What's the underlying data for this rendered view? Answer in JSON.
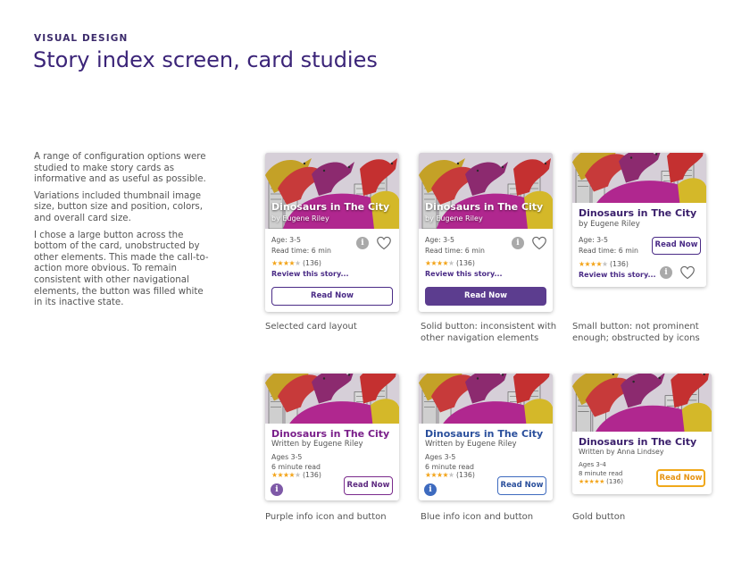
{
  "header": {
    "eyebrow": "VISUAL DESIGN",
    "title": "Story index screen, card studies"
  },
  "description": [
    "A range of configuration options were studied to make story cards as informative and as useful as possible.",
    "Variations included thumbnail image size, button size and position, colors, and overall card size.",
    "I chose a large button across the bottom of the card, unobstructed by other elements. This made the call-to-action more obvious. To remain consistent with other navigational elements, the button was filled white in its inactive state."
  ],
  "colors": {
    "title": "#3b2478",
    "button_purple": "#4a2b86",
    "button_solid": "#5c3d8f",
    "button_blue": "#3e6bbf",
    "button_gold": "#f0a81a",
    "star": "#f3a51c"
  },
  "cards": [
    {
      "title": "Dinosaurs in The City",
      "author": "by Eugene Riley",
      "age": "Age: 3-5",
      "read_time": "Read time: 6 min",
      "rating_stars": 4,
      "rating_count": "(136)",
      "review_link": "Review this story...",
      "button": "Read Now",
      "caption": "Selected card layout"
    },
    {
      "title": "Dinosaurs in The City",
      "author": "by Eugene Riley",
      "age": "Age: 3-5",
      "read_time": "Read time: 6 min",
      "rating_stars": 4,
      "rating_count": "(136)",
      "review_link": "Review this story...",
      "button": "Read Now",
      "caption": "Solid button: inconsistent with other navigation elements"
    },
    {
      "title": "Dinosaurs in The City",
      "author": "by Eugene Riley",
      "age": "Age: 3-5",
      "read_time": "Read time: 6 min",
      "rating_stars": 4,
      "rating_count": "(136)",
      "review_link": "Review this story...",
      "button": "Read Now",
      "caption": "Small button: not prominent enough; obstructed by icons"
    },
    {
      "title": "Dinosaurs in The City",
      "author": "Written by Eugene Riley",
      "age": "Ages 3-5",
      "read_time": "6 minute read",
      "rating_stars": 4,
      "rating_count": "(136)",
      "button": "Read Now",
      "caption": "Purple info icon and button"
    },
    {
      "title": "Dinosaurs in The City",
      "author": "Written by Eugene Riley",
      "age": "Ages 3-5",
      "read_time": "6 minute read",
      "rating_stars": 4,
      "rating_count": "(136)",
      "button": "Read Now",
      "caption": "Blue info icon and button"
    },
    {
      "title": "Dinosaurs in The City",
      "author": "Written by Anna Lindsey",
      "age": "Ages 3-4",
      "read_time": "8 minute read",
      "rating_stars": 5,
      "rating_count": "(136)",
      "button": "Read Now",
      "caption": "Gold button"
    }
  ],
  "icons": {
    "info": "i",
    "heart": "heart-outline-icon",
    "thumbnail": "dinosaur-illustration"
  }
}
